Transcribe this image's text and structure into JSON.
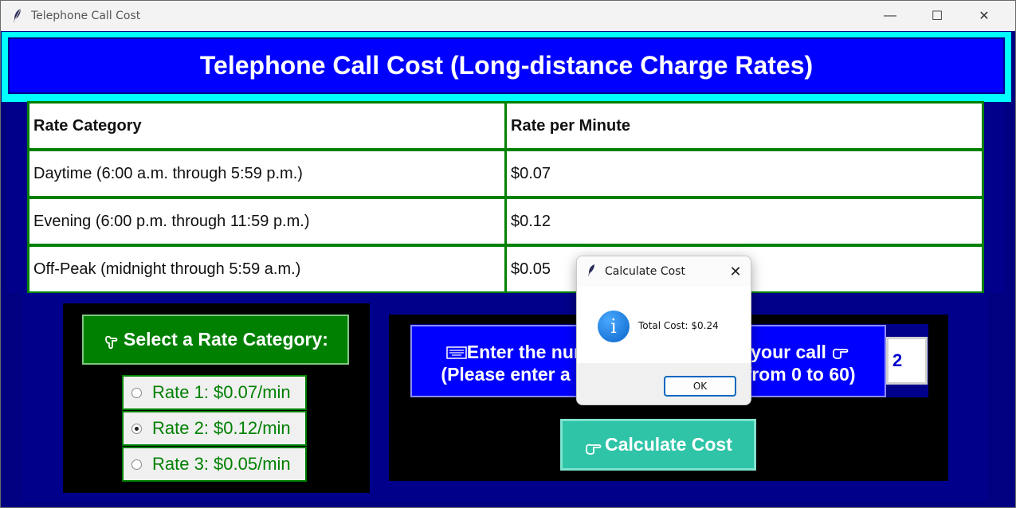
{
  "window": {
    "title": "Telephone Call Cost",
    "controls": {
      "minimize": "—",
      "maximize": "☐",
      "close": "✕"
    }
  },
  "header": {
    "title": "Telephone Call Cost (Long-distance Charge Rates)"
  },
  "rates_table": {
    "columns": [
      "Rate Category",
      "Rate per Minute"
    ],
    "rows": [
      [
        "Daytime (6:00 a.m. through 5:59 p.m.)",
        "$0.07"
      ],
      [
        "Evening (6:00 p.m. through 11:59 p.m.)",
        "$0.12"
      ],
      [
        "Off-Peak (midnight through 5:59 a.m.)",
        "$0.05"
      ]
    ]
  },
  "rate_selector": {
    "button_label": "Select a Rate Category:",
    "button_icon": "pointing-hand-down-icon",
    "options": [
      {
        "label": "Rate 1: $0.07/min",
        "selected": false
      },
      {
        "label": "Rate 2: $0.12/min",
        "selected": true
      },
      {
        "label": "Rate 3: $0.05/min",
        "selected": false
      }
    ]
  },
  "minutes": {
    "prompt_line1": "Enter the number of minutes for your call",
    "prompt_line2": "(Please enter a number of minutes from 0 to 60)",
    "prompt_icon_left": "keyboard-icon",
    "prompt_icon_right": "pointing-hand-right-icon",
    "value": "2"
  },
  "calculate": {
    "label": "Calculate Cost",
    "icon": "pointing-hand-right-icon"
  },
  "dialog": {
    "title": "Calculate Cost",
    "message": "Total Cost: $0.24",
    "ok_label": "OK",
    "icon": "info-icon"
  },
  "colors": {
    "header_bg": "#0000ff",
    "header_border": "#00ffff",
    "table_border": "#008000",
    "window_bg": "#000080",
    "select_button_bg": "#008000",
    "calculate_button_bg": "#2fc4a7",
    "dialog_ok_border": "#0067c0"
  }
}
